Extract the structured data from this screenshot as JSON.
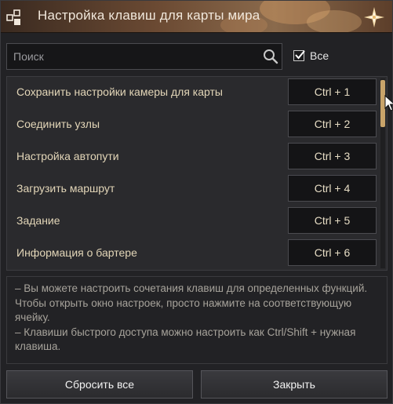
{
  "window": {
    "title": "Настройка клавиш для карты мира",
    "title_icon": "keyboard-shortcut-icon",
    "corner_icon": "star-ornament-icon"
  },
  "search": {
    "placeholder": "Поиск",
    "value": "",
    "icon": "search-icon"
  },
  "filter": {
    "all_label": "Все",
    "all_checked": true
  },
  "shortcuts": [
    {
      "label": "Сохранить настройки камеры для карты",
      "key": "Ctrl + 1"
    },
    {
      "label": "Соединить узлы",
      "key": "Ctrl + 2"
    },
    {
      "label": "Настройка автопути",
      "key": "Ctrl + 3"
    },
    {
      "label": "Загрузить маршрут",
      "key": "Ctrl + 4"
    },
    {
      "label": "Задание",
      "key": "Ctrl + 5"
    },
    {
      "label": "Информация о бартере",
      "key": "Ctrl + 6"
    }
  ],
  "info": {
    "line1": "– Вы можете настроить сочетания клавиш для определенных функций. Чтобы открыть окно настроек, просто нажмите на соответствующую ячейку.",
    "line2": "– Клавиши быстрого доступа можно настроить как Ctrl/Shift + нужная клавиша."
  },
  "buttons": {
    "reset_label": "Сбросить все",
    "close_label": "Закрыть"
  },
  "colors": {
    "accent": "#c9a46a",
    "label_text": "#e3d6b8"
  }
}
